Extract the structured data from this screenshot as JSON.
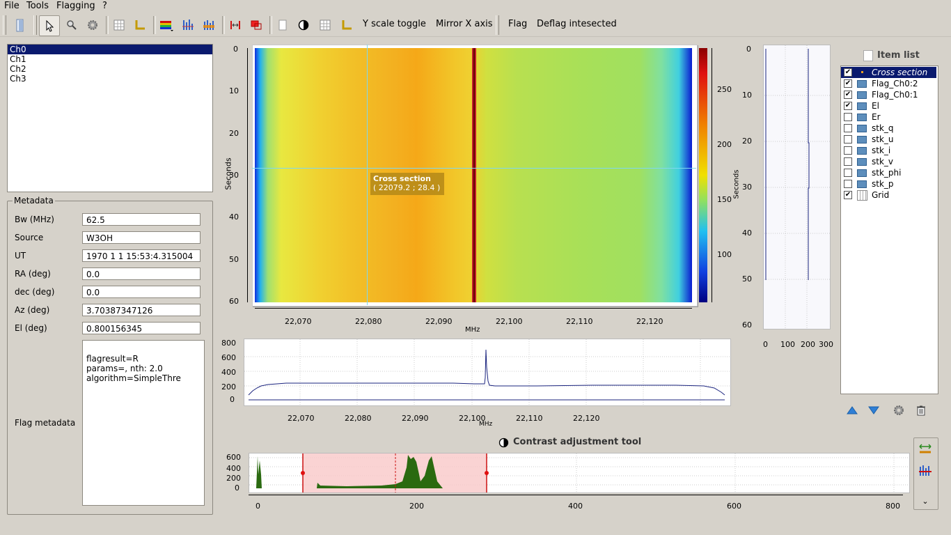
{
  "menu": [
    "File",
    "Tools",
    "Flagging",
    "?"
  ],
  "toolbar": {
    "icons": [
      "file-icon",
      "pointer-icon",
      "zoom-icon",
      "settings-icon",
      "grid-icon",
      "axis-icon",
      "colormap-icon",
      "histogram-icon",
      "flag-range-icon",
      "resize-icon",
      "crop-icon",
      "select-box-icon",
      "contrast-icon",
      "grid-toggle-icon",
      "axis-toggle-icon"
    ],
    "y_scale_toggle": "Y scale toggle",
    "mirror_x_axis": "Mirror X axis",
    "flag": "Flag",
    "deflag": "Deflag intesected"
  },
  "channels": [
    "Ch0",
    "Ch1",
    "Ch2",
    "Ch3"
  ],
  "selected_channel": "Ch0",
  "metadata": {
    "title": "Metadata",
    "fields": [
      {
        "label": "Bw (MHz)",
        "value": "62.5"
      },
      {
        "label": "Source",
        "value": "W3OH"
      },
      {
        "label": "UT",
        "value": "1970 1 1 15:53:4.315004"
      },
      {
        "label": "RA (deg)",
        "value": "0.0"
      },
      {
        "label": "dec (deg)",
        "value": "0.0"
      },
      {
        "label": "Az (deg)",
        "value": "3.70387347126"
      },
      {
        "label": "El (deg)",
        "value": "0.800156345"
      }
    ],
    "flag_label": "Flag metadata",
    "flag_lines": [
      "flagresult=R",
      "params=, nth: 2.0",
      "algorithm=SimpleThre"
    ]
  },
  "waterfall": {
    "ylabel": "Seconds",
    "xlabel": "MHz",
    "y_ticks": [
      "0",
      "10",
      "20",
      "30",
      "40",
      "50",
      "60"
    ],
    "x_ticks": [
      "22,070",
      "22,080",
      "22,090",
      "22,100",
      "22,110",
      "22,120"
    ],
    "colorbar_ticks": [
      "250",
      "200",
      "150",
      "100"
    ],
    "cross_title": "Cross section",
    "cross_coords": "( 22079.2 ; 28.4 )"
  },
  "side_plot": {
    "ylabel": "Seconds",
    "y_ticks": [
      "0",
      "10",
      "20",
      "30",
      "40",
      "50",
      "60"
    ],
    "x_ticks": [
      "0",
      "100",
      "200",
      "300"
    ]
  },
  "spectrum": {
    "xlabel": "MHz",
    "y_ticks": [
      "800",
      "600",
      "400",
      "200",
      "0"
    ],
    "x_ticks": [
      "22,070",
      "22,080",
      "22,090",
      "22,100",
      "22,110",
      "22,120"
    ]
  },
  "items": {
    "title": "Item list",
    "rows": [
      {
        "label": "Cross section",
        "checked": true,
        "selected": true
      },
      {
        "label": "Flag_Ch0:2",
        "checked": true
      },
      {
        "label": "Flag_Ch0:1",
        "checked": true
      },
      {
        "label": "El",
        "checked": true
      },
      {
        "label": "Er",
        "checked": false
      },
      {
        "label": "stk_q",
        "checked": false
      },
      {
        "label": "stk_u",
        "checked": false
      },
      {
        "label": "stk_i",
        "checked": false
      },
      {
        "label": "stk_v",
        "checked": false
      },
      {
        "label": "stk_phi",
        "checked": false
      },
      {
        "label": "stk_p",
        "checked": false
      },
      {
        "label": "Grid",
        "checked": true
      }
    ]
  },
  "contrast": {
    "title": "Contrast adjustment tool",
    "y_ticks": [
      "600",
      "400",
      "200",
      "0"
    ],
    "x_ticks": [
      "0",
      "200",
      "400",
      "600",
      "800"
    ]
  }
}
